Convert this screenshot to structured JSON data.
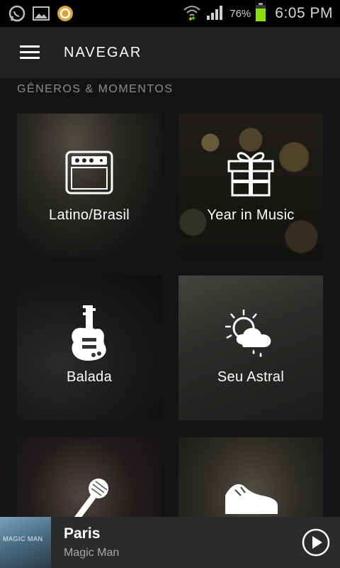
{
  "status_bar": {
    "battery_percent": "76%",
    "time": "6:05 PM",
    "icons": [
      "whatsapp-icon",
      "gallery-icon",
      "app-notification-icon",
      "wifi-icon",
      "signal-icon",
      "battery-icon"
    ]
  },
  "header": {
    "title": "NAVEGAR",
    "menu_icon": "hamburger-menu-icon"
  },
  "section": {
    "label": "GÊNEROS & MOMENTOS"
  },
  "tiles": [
    {
      "label": "Latino/Brasil",
      "icon": "amplifier-icon"
    },
    {
      "label": "Year in Music",
      "icon": "gift-icon"
    },
    {
      "label": "Balada",
      "icon": "guitar-icon"
    },
    {
      "label": "Seu Astral",
      "icon": "weather-icon"
    },
    {
      "label": "",
      "icon": "microphone-icon"
    },
    {
      "label": "",
      "icon": "sneaker-icon"
    }
  ],
  "now_playing": {
    "title": "Paris",
    "artist": "Magic Man",
    "cover_text": "MAGIC MAN",
    "play_icon": "play-icon"
  }
}
